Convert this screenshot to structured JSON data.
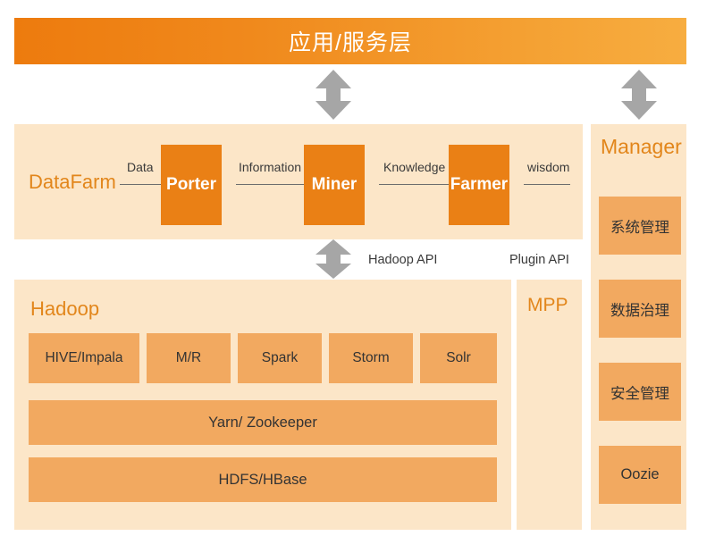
{
  "banner": {
    "title": "应用/服务层"
  },
  "arrows": {
    "left_arrow_name": "double-headed-arrow",
    "right_arrow_name": "double-headed-arrow",
    "mid_arrow_name": "double-headed-arrow",
    "color": "#A6A6A6"
  },
  "datafarm": {
    "title": "DataFarm",
    "stages": [
      {
        "label": "Porter",
        "edge_label": "Data"
      },
      {
        "label": "Miner",
        "edge_label": "Information"
      },
      {
        "label": "Farmer",
        "edge_label": "Knowledge"
      }
    ],
    "final_edge_label": "wisdom"
  },
  "api_labels": {
    "hadoop_api": "Hadoop API",
    "plugin_api": "Plugin API"
  },
  "hadoop": {
    "title": "Hadoop",
    "components": [
      "HIVE/Impala",
      "M/R",
      "Spark",
      "Storm",
      "Solr"
    ],
    "middle_layer": "Yarn/ Zookeeper",
    "bottom_layer": "HDFS/HBase"
  },
  "mpp": {
    "title": "MPP"
  },
  "manager": {
    "title": "Manager",
    "items": [
      "系统管理",
      "数据治理",
      "安全管理",
      "Oozie"
    ]
  },
  "colors": {
    "banner_start": "#ED7B0E",
    "banner_end": "#F7AD40",
    "panel_bg": "#FCE6C8",
    "box_bg": "#F2A960",
    "stage_bg": "#EA8015",
    "title_text": "#E2861B",
    "arrow": "#A6A6A6"
  }
}
